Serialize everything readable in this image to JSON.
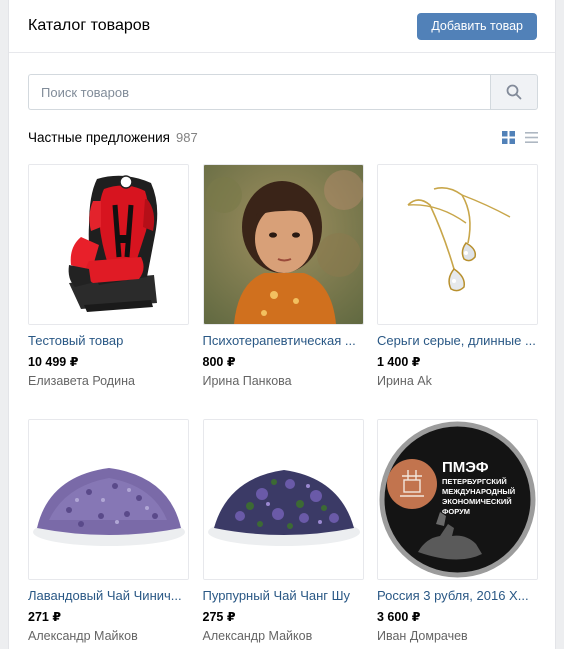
{
  "header": {
    "title": "Каталог товаров",
    "add_button": "Добавить товар"
  },
  "search": {
    "placeholder": "Поиск товаров",
    "value": ""
  },
  "section": {
    "title": "Частные предложения",
    "count": "987"
  },
  "products": [
    {
      "title": "Тестовый товар",
      "price": "10 499 ₽",
      "seller": "Елизавета Родина",
      "image": "car-seat-image"
    },
    {
      "title": "Психотерапевтическая ...",
      "price": "800 ₽",
      "seller": "Ирина Панкова",
      "image": "child-portrait-image"
    },
    {
      "title": "Серьги серые, длинные ...",
      "price": "1 400 ₽",
      "seller": "Ирина Ak",
      "image": "earrings-image"
    },
    {
      "title": "Лавандовый Чай Чинич...",
      "price": "271 ₽",
      "seller": "Александр Майков",
      "image": "lavender-tea-image"
    },
    {
      "title": "Пурпурный Чай Чанг Шу",
      "price": "275 ₽",
      "seller": "Александр Майков",
      "image": "purple-tea-image"
    },
    {
      "title": "Россия 3 рубля, 2016 Х...",
      "price": "3 600 ₽",
      "seller": "Иван Домрачев",
      "image": "coin-image"
    }
  ],
  "coin": {
    "line1": "ПМЭФ",
    "line2": "ПЕТЕРБУРГСКИЙ",
    "line3": "МЕЖДУНАРОДНЫЙ",
    "line4": "ЭКОНОМИЧЕСКИЙ",
    "line5": "ФОРУМ"
  },
  "colors": {
    "accent": "#5181b8",
    "link": "#2a5885",
    "muted": "#656565"
  }
}
